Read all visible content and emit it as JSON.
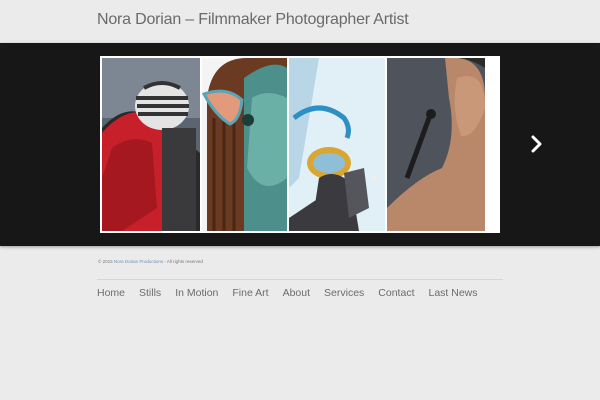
{
  "site": {
    "title": "Nora Dorian – Filmmaker Photographer Artist"
  },
  "slider": {
    "next_icon": "chevron-right-icon"
  },
  "footer": {
    "copyright_prefix": "© 2015",
    "company_link": "Nora Dorian Productions",
    "copyright_suffix": "- All rights reserved"
  },
  "nav": {
    "items": [
      {
        "label": "Home"
      },
      {
        "label": "Stills"
      },
      {
        "label": "In Motion"
      },
      {
        "label": "Fine Art"
      },
      {
        "label": "About"
      },
      {
        "label": "Services"
      },
      {
        "label": "Contact"
      },
      {
        "label": "Last News"
      }
    ]
  },
  "colors": {
    "background": "#ebebeb",
    "slider_bg": "#171717",
    "text": "#6b6b6b",
    "link": "#6f8fb0"
  }
}
